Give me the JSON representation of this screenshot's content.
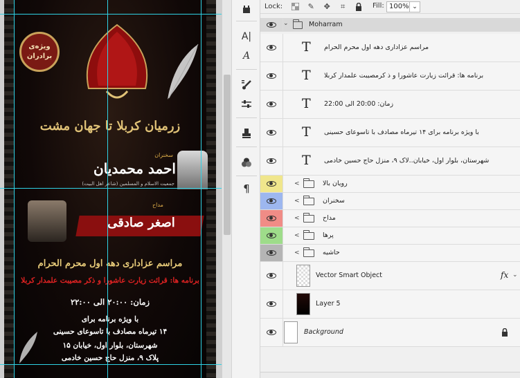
{
  "poster": {
    "badge_line1": "ویژه‌ی",
    "badge_line2": "برادران",
    "calligraphy": "زرمیان کربلا تا جهان مشت",
    "speaker": {
      "role": "سخنران",
      "name": "احمد محمدیان",
      "subtitle": "جمعیت الاسلام و المسلمین (شاعر اهل البیت)"
    },
    "singer": {
      "role": "مداح",
      "name": "اصغر صادقی"
    },
    "line_muharram": "مراسم عزاداری دهه اول محرم الحرام",
    "line_program": "برنامه ها: قرائت زیارت عاشورا و ذکر مصیبت علمدار کربلا",
    "line_time": "زمان: ۲۰:۰۰ الی ۲۲:۰۰",
    "line_p1": "با ویژه برنامه برای",
    "line_p2": "۱۴ تیرماه مصادف با تاسوعای حسینی",
    "line_p3": "شهرستان، بلوار اول، خیابان ۱۵",
    "line_p4": "پلاک ۹، منزل حاج حسین خادمی"
  },
  "toolbar": {
    "tools": [
      "grid-tool-icon",
      "character-panel-icon",
      "glyph-panel-icon",
      "brush-tool-icon",
      "adjustments-icon",
      "clone-stamp-icon",
      "color-circles-icon",
      "paragraph-icon"
    ]
  },
  "layers_panel": {
    "lock_label": "Lock:",
    "fill_label": "Fill:",
    "fill_value": "100%",
    "group_name": "Moharram",
    "text_layers": [
      "مراسم عزاداری دهه اول محرم الحرام",
      "برنامه ها: قرائت زیارت عاشورا  و ذ کرمصیبت علمدار کربلا",
      "زمان: 20:00 الی 22:00",
      "با ویژه برنامه برای ۱۴ تیرماه مصادف با تاسوعای حسینی",
      "شهرستان، بلوار اول، خیابان..لاک ۹، منزل حاج حسین خادمی"
    ],
    "sub_groups": [
      {
        "name": "رویان بالا",
        "color": "#f0e68c"
      },
      {
        "name": "سخنران",
        "color": "#9db7ef"
      },
      {
        "name": "مداح",
        "color": "#f08c86"
      },
      {
        "name": "پرها",
        "color": "#9edc8a"
      },
      {
        "name": "حاشیه",
        "color": "#b5b5b5"
      }
    ],
    "smart_object": "Vector Smart Object",
    "fx_label": "fx",
    "layer5": "Layer 5",
    "background": "Background"
  }
}
